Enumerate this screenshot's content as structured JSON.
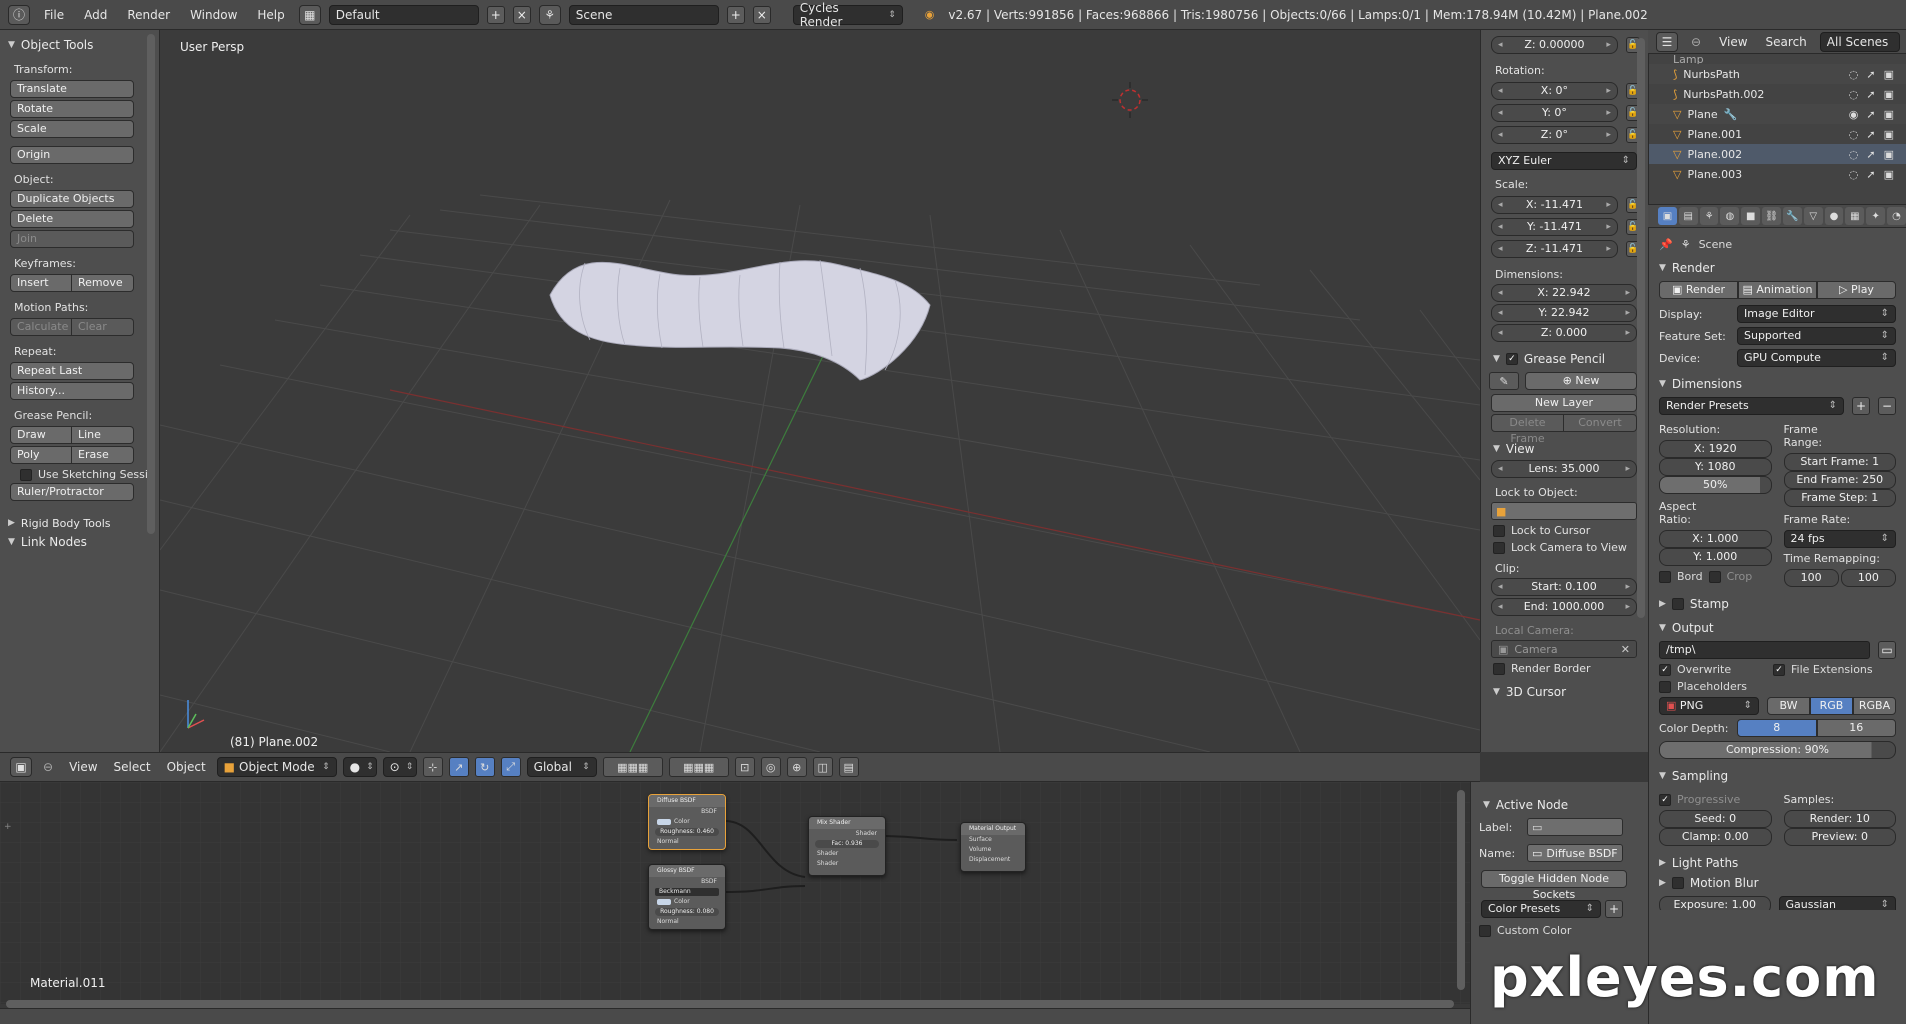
{
  "topbar": {
    "menus": [
      "File",
      "Add",
      "Render",
      "Window",
      "Help"
    ],
    "layout": "Default",
    "scene": "Scene",
    "engine": "Cycles Render",
    "stats": "v2.67 | Verts:991856 | Faces:968866 | Tris:1980756 | Objects:0/66 | Lamps:0/1 | Mem:178.94M (10.42M) | Plane.002"
  },
  "toolshelf": {
    "title": "Object Tools",
    "transform_label": "Transform:",
    "translate": "Translate",
    "rotate": "Rotate",
    "scale": "Scale",
    "origin": "Origin",
    "object_label": "Object:",
    "duplicate": "Duplicate Objects",
    "delete": "Delete",
    "join": "Join",
    "keyframes_label": "Keyframes:",
    "insert": "Insert",
    "remove": "Remove",
    "motion_label": "Motion Paths:",
    "calculate": "Calculate",
    "clear": "Clear",
    "repeat_label": "Repeat:",
    "repeat_last": "Repeat Last",
    "history": "History...",
    "grease_label": "Grease Pencil:",
    "draw": "Draw",
    "line": "Line",
    "poly": "Poly",
    "erase": "Erase",
    "sketching": "Use Sketching Sessi",
    "ruler": "Ruler/Protractor",
    "rigid_body": "Rigid Body Tools",
    "link_nodes": "Link Nodes"
  },
  "viewport": {
    "persp": "User Persp",
    "object": "(81) Plane.002"
  },
  "view3d_header": {
    "menus": [
      "View",
      "Select",
      "Object"
    ],
    "mode": "Object Mode",
    "orientation": "Global"
  },
  "npanel": {
    "loc_z": "Z: 0.00000",
    "rotation_label": "Rotation:",
    "rot_x": "X: 0°",
    "rot_y": "Y: 0°",
    "rot_z": "Z: 0°",
    "rot_mode": "XYZ Euler",
    "scale_label": "Scale:",
    "scale_x": "X: -11.471",
    "scale_y": "Y: -11.471",
    "scale_z": "Z: -11.471",
    "dim_label": "Dimensions:",
    "dim_x": "X: 22.942",
    "dim_y": "Y: 22.942",
    "dim_z": "Z: 0.000",
    "grease_pencil": "Grease Pencil",
    "new": "New",
    "new_layer": "New Layer",
    "delete_frame": "Delete Frame",
    "convert": "Convert",
    "view": "View",
    "lens": "Lens: 35.000",
    "lock_to_object": "Lock to Object:",
    "lock_to_cursor": "Lock to Cursor",
    "lock_camera": "Lock Camera to View",
    "clip_label": "Clip:",
    "clip_start": "Start: 0.100",
    "clip_end": "End: 1000.000",
    "local_camera": "Local Camera:",
    "camera": "Camera",
    "render_border": "Render Border",
    "cursor_3d": "3D Cursor"
  },
  "outliner": {
    "view": "View",
    "search": "Search",
    "scope": "All Scenes",
    "rows": [
      {
        "name": "Lamp"
      },
      {
        "name": "NurbsPath"
      },
      {
        "name": "NurbsPath.002"
      },
      {
        "name": "Plane"
      },
      {
        "name": "Plane.001"
      },
      {
        "name": "Plane.002"
      },
      {
        "name": "Plane.003"
      }
    ]
  },
  "properties": {
    "scene": "Scene",
    "render_section": "Render",
    "render_btn": "Render",
    "animation_btn": "Animation",
    "play_btn": "Play",
    "display_label": "Display:",
    "display": "Image Editor",
    "feature_label": "Feature Set:",
    "feature": "Supported",
    "device_label": "Device:",
    "device": "GPU Compute",
    "dimensions_section": "Dimensions",
    "render_presets": "Render Presets",
    "resolution_label": "Resolution:",
    "res_x": "X: 1920",
    "res_y": "Y: 1080",
    "res_pct": "50%",
    "frame_range_label": "Frame Range:",
    "start_frame": "Start Frame: 1",
    "end_frame": "End Frame: 250",
    "frame_step": "Frame Step: 1",
    "aspect_label": "Aspect Ratio:",
    "aspect_x": "X: 1.000",
    "aspect_y": "Y: 1.000",
    "frame_rate_label": "Frame Rate:",
    "frame_rate": "24 fps",
    "time_remap_label": "Time Remapping:",
    "remap_old": "100",
    "remap_new": "100",
    "bord": "Bord",
    "crop": "Crop",
    "stamp_section": "Stamp",
    "output_section": "Output",
    "output_path": "/tmp\\",
    "overwrite": "Overwrite",
    "file_ext": "File Extensions",
    "placeholders": "Placeholders",
    "format": "PNG",
    "bw": "BW",
    "rgb": "RGB",
    "rgba": "RGBA",
    "color_depth_label": "Color Depth:",
    "depth_8": "8",
    "depth_16": "16",
    "compression": "Compression: 90%",
    "sampling_section": "Sampling",
    "progressive": "Progressive",
    "samples_label": "Samples:",
    "seed": "Seed: 0",
    "clamp": "Clamp: 0.00",
    "render_samples": "Render: 10",
    "preview_samples": "Preview: 0",
    "light_paths_section": "Light Paths",
    "motion_blur_section": "Motion Blur",
    "exposure": "Exposure: 1.00",
    "filter": "Gaussian"
  },
  "node_side": {
    "active_node": "Active Node",
    "label_label": "Label:",
    "name_label": "Name:",
    "name": "Diffuse BSDF",
    "toggle_sockets": "Toggle Hidden Node Sockets",
    "color_presets": "Color Presets",
    "custom_color": "Custom Color"
  },
  "nodes": {
    "diffuse_title": "Diffuse BSDF",
    "diffuse_out": "BSDF",
    "color": "Color",
    "diffuse_rough": "Roughness: 0.460",
    "normal": "Normal",
    "glossy_title": "Glossy BSDF",
    "glossy_out": "BSDF",
    "glossy_dist": "Beckmann",
    "glossy_rough": "Roughness: 0.080",
    "mix_title": "Mix Shader",
    "mix_out": "Shader",
    "mix_fac": "Fac: 0.936",
    "mix_in1": "Shader",
    "mix_in2": "Shader",
    "out_title": "Material Output",
    "surface": "Surface",
    "volume": "Volume",
    "displacement": "Displacement"
  },
  "material": "Material.011",
  "watermark": "pxleyes.com",
  "colors": {
    "accent": "#5680c2",
    "selection": "#e8a23a"
  }
}
